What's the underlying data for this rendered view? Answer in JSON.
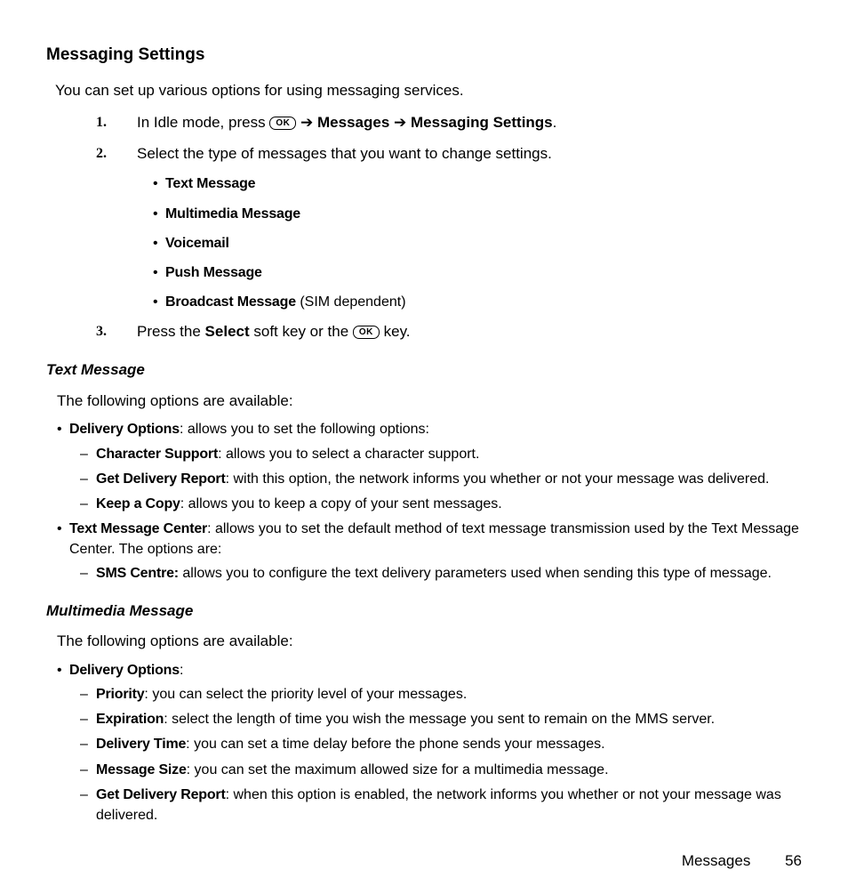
{
  "heading": "Messaging Settings",
  "intro": "You can set up various options for using messaging services.",
  "steps": {
    "s1": {
      "num": "1.",
      "pre": "In Idle mode, press ",
      "ok": "OK",
      "arr": " ➔ ",
      "b1": "Messages",
      "b2": "Messaging Settings",
      "end": "."
    },
    "s2": {
      "num": "2.",
      "text": "Select the type of messages that you want to change settings.",
      "items": {
        "a": "Text Message",
        "b": "Multimedia Message",
        "c": "Voicemail",
        "d": "Push Message",
        "e": "Broadcast Message",
        "e_note": " (SIM dependent)"
      }
    },
    "s3": {
      "num": "3.",
      "pre": "Press the ",
      "b1": "Select",
      "mid": " soft key or the ",
      "ok": "OK",
      "end": " key."
    }
  },
  "text_msg": {
    "title": "Text Message",
    "intro": "The following options are available:",
    "do_label": "Delivery Options",
    "do_tail": ": allows you to set the following options:",
    "cs_label": "Character Support",
    "cs_tail": ": allows you to select a character support.",
    "gdr_label": "Get Delivery Report",
    "gdr_tail": ": with this option, the network informs you whether or not your message was delivered.",
    "kc_label": "Keep a Copy",
    "kc_tail": ": allows you to keep a copy of your sent messages.",
    "tmc_label": "Text Message Center",
    "tmc_tail": ": allows you to set the default method of text message transmission used by the Text Message Center. The options are:",
    "sms_label": "SMS Centre:",
    "sms_tail": " allows you to configure the text delivery parameters used when sending this type of message."
  },
  "mm": {
    "title": "Multimedia Message",
    "intro": "The following options are available:",
    "do_label": "Delivery Options",
    "do_tail": ":",
    "pr_label": "Priority",
    "pr_tail": ": you can select the priority level of your messages.",
    "ex_label": "Expiration",
    "ex_tail": ": select the length of time you wish the message you sent to remain on the MMS server.",
    "dt_label": "Delivery Time",
    "dt_tail": ": you can set a time delay before the phone sends your messages.",
    "ms_label": "Message Size",
    "ms_tail": ": you can set the maximum allowed size for a multimedia message.",
    "gdr_label": "Get Delivery Report",
    "gdr_tail": ": when this option is enabled, the network informs you whether or not your message was delivered."
  },
  "footer": {
    "section": "Messages",
    "page": "56"
  }
}
